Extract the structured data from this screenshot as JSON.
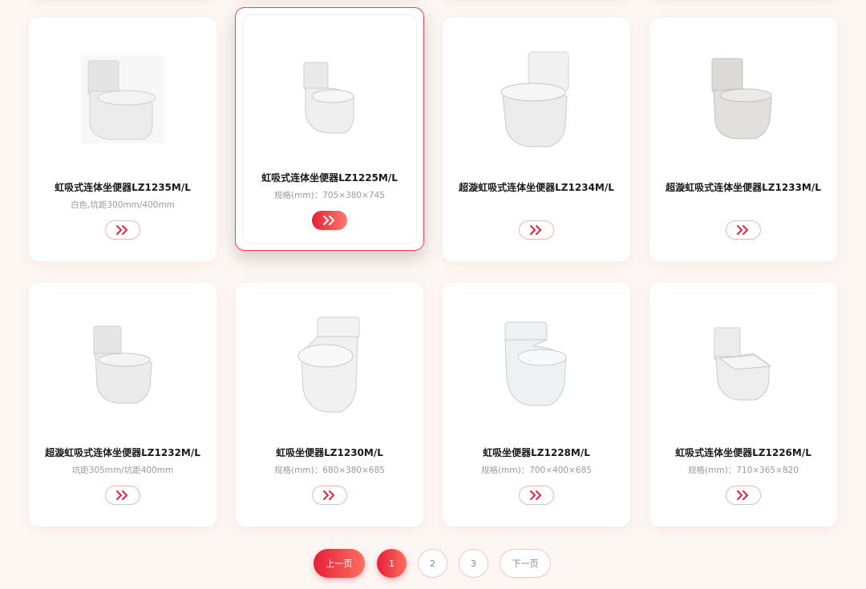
{
  "products": [
    {
      "title": "虹吸式连体坐便器LZ1235M/L",
      "spec": "白色,坑距300mm/400mm",
      "image_icon": "toilet-image",
      "more_icon": "double-chevron-right-icon",
      "active": false
    },
    {
      "title": "虹吸式连体坐便器LZ1225M/L",
      "spec": "规格(mm)：705×380×745",
      "image_icon": "toilet-image",
      "more_icon": "double-chevron-right-icon",
      "active": true
    },
    {
      "title": "超漩虹吸式连体坐便器LZ1234M/L",
      "spec": "",
      "image_icon": "toilet-image",
      "more_icon": "double-chevron-right-icon",
      "active": false
    },
    {
      "title": "超漩虹吸式连体坐便器LZ1233M/L",
      "spec": "",
      "image_icon": "toilet-image",
      "more_icon": "double-chevron-right-icon",
      "active": false
    },
    {
      "title": "超漩虹吸式连体坐便器LZ1232M/L",
      "spec": "坑距305mm/坑距400mm",
      "image_icon": "toilet-image",
      "more_icon": "double-chevron-right-icon",
      "active": false
    },
    {
      "title": "虹吸坐便器LZ1230M/L",
      "spec": "规格(mm)：680×380×685",
      "image_icon": "toilet-image",
      "more_icon": "double-chevron-right-icon",
      "active": false
    },
    {
      "title": "虹吸坐便器LZ1228M/L",
      "spec": "规格(mm)：700×400×685",
      "image_icon": "toilet-image",
      "more_icon": "double-chevron-right-icon",
      "active": false
    },
    {
      "title": "虹吸式连体坐便器LZ1226M/L",
      "spec": "规格(mm)：710×365×820",
      "image_icon": "toilet-image",
      "more_icon": "double-chevron-right-icon",
      "active": false
    }
  ],
  "pagination": {
    "prev_label": "上一页",
    "pages": [
      "1",
      "2",
      "3"
    ],
    "current_page": "1",
    "next_label": "下一页"
  },
  "colors": {
    "background": "#fdf7f4",
    "accent_start": "#e61f3a",
    "accent_end": "#ff7a6a",
    "outline": "#f4b4ab"
  }
}
